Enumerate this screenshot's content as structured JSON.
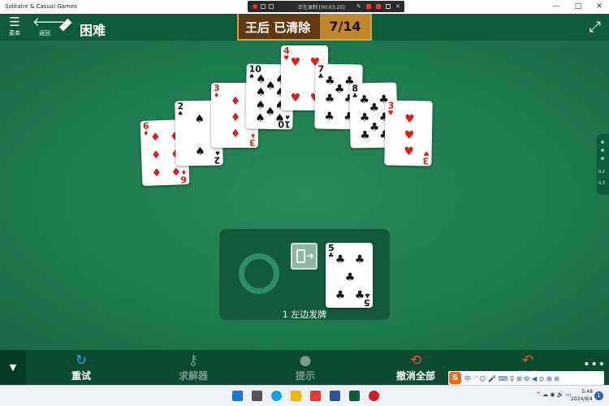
{
  "window": {
    "title": "Solitaire & Casual Games",
    "recording_text": "正在录制 [00:03:25]",
    "controls": [
      "—",
      "□",
      "✕"
    ]
  },
  "header": {
    "menu_label": "菜单",
    "back_label": "返回",
    "difficulty": "困难",
    "goal": "王后 已清除",
    "progress": "7/14"
  },
  "tableau": [
    {
      "rank": "6",
      "suit": "♦",
      "color": "red"
    },
    {
      "rank": "2",
      "suit": "♠",
      "color": "black"
    },
    {
      "rank": "3",
      "suit": "♦",
      "color": "red"
    },
    {
      "rank": "10",
      "suit": "♠",
      "color": "black"
    },
    {
      "rank": "4",
      "suit": "♥",
      "color": "red"
    },
    {
      "rank": "7",
      "suit": "♣",
      "color": "black"
    },
    {
      "rank": "8",
      "suit": "♣",
      "color": "black"
    },
    {
      "rank": "3",
      "suit": "♥",
      "color": "red"
    }
  ],
  "waste_card": {
    "rank": "5",
    "suit": "♣",
    "color": "black"
  },
  "stock_hint": "1 左边发牌",
  "side_indicator": [
    "0.2",
    "0.3"
  ],
  "toolbar": {
    "restart": "重试",
    "solver": "求解器",
    "hint": "提示",
    "undo_all": "撤消全部",
    "undo": "撤消",
    "more_label": "更多"
  },
  "ime": {
    "logo": "S",
    "items": "中 ·ʼ ☺ 🎤 ⌨ ♀ ⊞ ⚙ ◀ ⊙ ⊞ ⊞"
  },
  "taskbar": {
    "clock_time": "5:48",
    "clock_date": "2024/9/4",
    "notifications": "1",
    "tray": "^ ☁ ◉ 🔊 ▭"
  },
  "colors": {
    "felt": "#1f7a50",
    "header": "#0f5a38",
    "status_bg": "#5e3a14",
    "status_accent": "#c1862a",
    "red_suit": "#d8211e"
  }
}
